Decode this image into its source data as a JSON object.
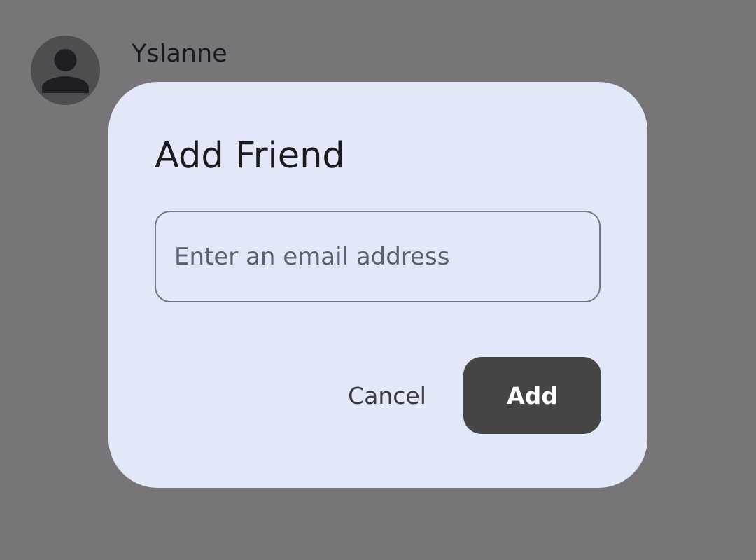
{
  "contact": {
    "name": "Yslanne",
    "avatar_icon": "person-icon"
  },
  "dialog": {
    "title": "Add Friend",
    "email_field": {
      "value": "",
      "placeholder": "Enter an email address"
    },
    "cancel_label": "Cancel",
    "add_label": "Add"
  },
  "colors": {
    "scrim": "#777578",
    "dialog_background": "#e2e8f8",
    "primary_button": "#454545",
    "avatar_background": "#4e4d50"
  }
}
